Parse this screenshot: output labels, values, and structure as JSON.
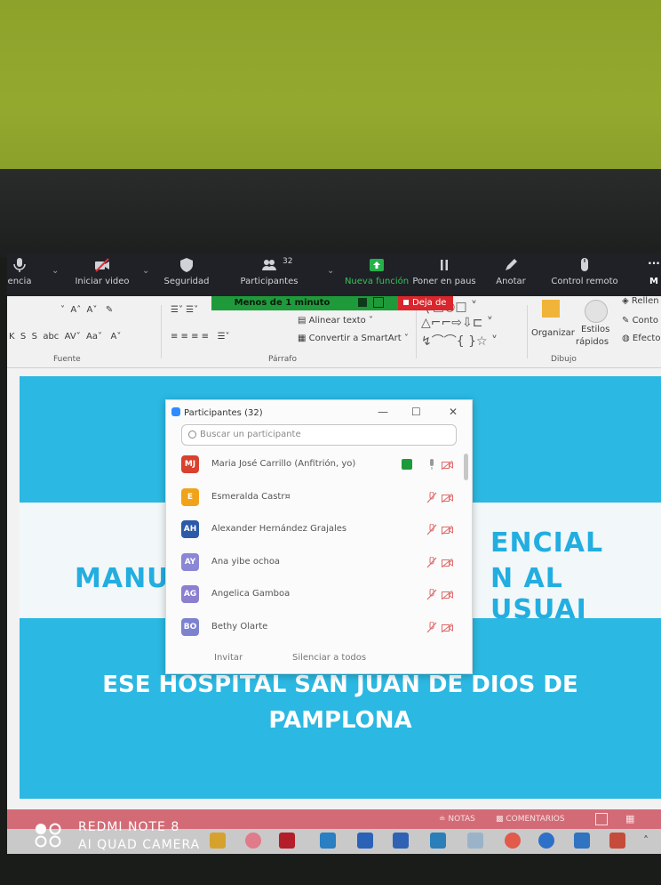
{
  "zoom_toolbar": {
    "items": [
      {
        "label": "encia"
      },
      {
        "label": "Iniciar video"
      },
      {
        "label": "Seguridad"
      },
      {
        "label": "Participantes"
      },
      {
        "label": "Nueva función"
      },
      {
        "label": "Poner en paus"
      },
      {
        "label": "Anotar"
      },
      {
        "label": "Control remoto"
      },
      {
        "label": "M"
      }
    ],
    "participant_count": "32",
    "timer_label": "Menos de 1 minuto",
    "stop_label": "Deja de"
  },
  "ribbon": {
    "font_group": "Fuente",
    "paragraph_group": "Párrafo",
    "drawing_group": "Dibujo",
    "align_text": "Alinear texto",
    "convert_smartart": "Convertir a SmartArt",
    "arrange": "Organizar",
    "quick_styles_1": "Estilos",
    "quick_styles_2": "rápidos",
    "fill": "Rellen",
    "outline": "Conto",
    "effects": "Efecto"
  },
  "slide": {
    "title_right_1": "ENCIAL",
    "title_left_2": "MANU",
    "title_right_2": "N AL USUAI",
    "subtitle_1": "ESE HOSPITAL SAN JUAN DE DIOS DE",
    "subtitle_2": "PAMPLONA"
  },
  "participants_panel": {
    "title": "Participantes (32)",
    "search_placeholder": "Buscar un participante",
    "participants": [
      {
        "initials": "MJ",
        "name": "Maria José Carrillo (Anfitrión, yo)",
        "color": "#d9412f",
        "sharing": true
      },
      {
        "initials": "E",
        "name": "Esmeralda Castr¤",
        "color": "#f0a31a",
        "sharing": false
      },
      {
        "initials": "AH",
        "name": "Alexander Hernández Grajales",
        "color": "#2c5aa8",
        "sharing": false
      },
      {
        "initials": "AY",
        "name": "Ana yibe ochoa",
        "color": "#8b87d6",
        "sharing": false
      },
      {
        "initials": "AG",
        "name": "Angelica Gamboa",
        "color": "#8b7fd0",
        "sharing": false
      },
      {
        "initials": "BO",
        "name": "Bethy Olarte",
        "color": "#7c82cf",
        "sharing": false
      }
    ],
    "invite_label": "Invitar",
    "mute_all_label": "Silenciar a todos"
  },
  "status_bar": {
    "notes": "NOTAS",
    "comments": "COMENTARIOS"
  },
  "watermark": {
    "line1": "REDMI NOTE 8",
    "line2": "AI QUAD CAMERA"
  },
  "colors": {
    "zoom_bar": "#1f2126",
    "timer_green": "#1f9a3a",
    "stop_red": "#d8262c",
    "slide_blue": "#2bb8e2",
    "title_blue": "#22aee0"
  }
}
